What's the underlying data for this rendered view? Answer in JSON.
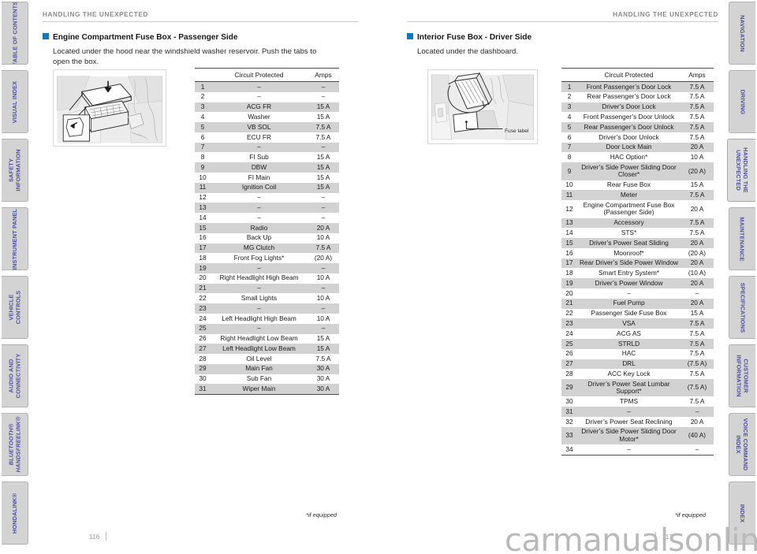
{
  "document": {
    "watermark": "carmanualsonline.info",
    "running_head": "HANDLING THE UNEXPECTED",
    "accent_color": "#1278bd",
    "tab_text_color": "#4b4fa0",
    "tab_bg_color": "#d3d3d3",
    "row_shade_color": "#d2d2d2"
  },
  "left_rail": {
    "items": [
      {
        "label": "TABLE OF CONTENTS",
        "active": false,
        "italic": false
      },
      {
        "label": "VISUAL INDEX",
        "active": false,
        "italic": false
      },
      {
        "label": "SAFETY\nINFORMATION",
        "active": false,
        "italic": false
      },
      {
        "label": "INSTRUMENT PANEL",
        "active": false,
        "italic": false
      },
      {
        "label": "VEHICLE\nCONTROLS",
        "active": false,
        "italic": false
      },
      {
        "label": "AUDIO AND\nCONNECTIVITY",
        "active": false,
        "italic": false
      },
      {
        "label": "BLUETOOTH®\nHANDSFREELINK®",
        "active": false,
        "italic": true
      },
      {
        "label": "HONDALINK®",
        "active": false,
        "italic": false
      }
    ]
  },
  "right_rail": {
    "items": [
      {
        "label": "NAVIGATION",
        "active": false,
        "italic": false
      },
      {
        "label": "DRIVING",
        "active": false,
        "italic": false
      },
      {
        "label": "HANDLING THE\nUNEXPECTED",
        "active": true,
        "italic": false
      },
      {
        "label": "MAINTENANCE",
        "active": false,
        "italic": false
      },
      {
        "label": "SPECIFICATIONS",
        "active": false,
        "italic": false
      },
      {
        "label": "CUSTOMER\nINFORMATION",
        "active": false,
        "italic": false
      },
      {
        "label": "VOICE COMMAND\nINDEX",
        "active": false,
        "italic": false
      },
      {
        "label": "INDEX",
        "active": false,
        "italic": false
      }
    ]
  },
  "left_page": {
    "running_head": "HANDLING THE UNEXPECTED",
    "section_title": "Engine Compartment Fuse Box - Passenger Side",
    "body_text": "Located under the hood near the windshield washer reservoir. Push the tabs to open the box.",
    "illustration_caption": "",
    "footnote": "*if equipped",
    "page_number": "116",
    "table": {
      "headers": [
        "",
        "Circuit Protected",
        "Amps"
      ],
      "rows": [
        [
          "1",
          "–",
          "–"
        ],
        [
          "2",
          "–",
          "–"
        ],
        [
          "3",
          "ACG FR",
          "15 A"
        ],
        [
          "4",
          "Washer",
          "15 A"
        ],
        [
          "5",
          "VB SOL",
          "7.5 A"
        ],
        [
          "6",
          "ECU FR",
          "7.5 A"
        ],
        [
          "7",
          "–",
          "–"
        ],
        [
          "8",
          "FI Sub",
          "15 A"
        ],
        [
          "9",
          "DBW",
          "15 A"
        ],
        [
          "10",
          "FI Main",
          "15 A"
        ],
        [
          "11",
          "Ignition Coil",
          "15 A"
        ],
        [
          "12",
          "–",
          "–"
        ],
        [
          "13",
          "–",
          "–"
        ],
        [
          "14",
          "–",
          "–"
        ],
        [
          "15",
          "Radio",
          "20 A"
        ],
        [
          "16",
          "Back Up",
          "10 A"
        ],
        [
          "17",
          "MG Clutch",
          "7.5 A"
        ],
        [
          "18",
          "Front Fog Lights*",
          "(20 A)"
        ],
        [
          "19",
          "–",
          "–"
        ],
        [
          "20",
          "Right Headlight High Beam",
          "10 A"
        ],
        [
          "21",
          "–",
          "–"
        ],
        [
          "22",
          "Small Lights",
          "10 A"
        ],
        [
          "23",
          "–",
          "–"
        ],
        [
          "24",
          "Left Headlight High Beam",
          "10 A"
        ],
        [
          "25",
          "–",
          "–"
        ],
        [
          "26",
          "Right Headlight Low Beam",
          "15 A"
        ],
        [
          "27",
          "Left Headlight Low Beam",
          "15 A"
        ],
        [
          "28",
          "Oil Level",
          "7.5 A"
        ],
        [
          "29",
          "Main Fan",
          "30 A"
        ],
        [
          "30",
          "Sub Fan",
          "30 A"
        ],
        [
          "31",
          "Wiper Main",
          "30 A"
        ]
      ]
    }
  },
  "right_page": {
    "running_head": "HANDLING THE UNEXPECTED",
    "section_title": "Interior Fuse Box - Driver Side",
    "body_text": "Located under the dashboard.",
    "illustration_caption": "Fuse label",
    "footnote": "*if equipped",
    "page_number": "117",
    "table": {
      "headers": [
        "",
        "Circuit Protected",
        "Amps"
      ],
      "rows": [
        [
          "1",
          "Front Passenger’s Door Lock",
          "7.5 A"
        ],
        [
          "2",
          "Rear Passenger’s Door Lock",
          "7.5 A"
        ],
        [
          "3",
          "Driver’s Door Lock",
          "7.5 A"
        ],
        [
          "4",
          "Front Passenger’s Door Unlock",
          "7.5 A"
        ],
        [
          "5",
          "Rear Passenger’s Door Unlock",
          "7.5 A"
        ],
        [
          "6",
          "Driver’s Door Unlock",
          "7.5 A"
        ],
        [
          "7",
          "Door Lock Main",
          "20 A"
        ],
        [
          "8",
          "HAC Option*",
          "10 A"
        ],
        [
          "9",
          "Driver’s Side Power Sliding Door Closer*",
          "(20 A)"
        ],
        [
          "10",
          "Rear Fuse Box",
          "15 A"
        ],
        [
          "11",
          "Meter",
          "7.5 A"
        ],
        [
          "12",
          "Engine Compartment Fuse Box (Passenger Side)",
          "20 A"
        ],
        [
          "13",
          "Accessory",
          "7.5 A"
        ],
        [
          "14",
          "STS*",
          "7.5 A"
        ],
        [
          "15",
          "Driver’s Power Seat Sliding",
          "20 A"
        ],
        [
          "16",
          "Moonroof*",
          "(20 A)"
        ],
        [
          "17",
          "Rear Driver’s Side Power Window",
          "20 A"
        ],
        [
          "18",
          "Smart Entry System*",
          "(10 A)"
        ],
        [
          "19",
          "Driver’s Power Window",
          "20 A"
        ],
        [
          "20",
          "–",
          "–"
        ],
        [
          "21",
          "Fuel Pump",
          "20 A"
        ],
        [
          "22",
          "Passenger Side Fuse Box",
          "15 A"
        ],
        [
          "23",
          "VSA",
          "7.5 A"
        ],
        [
          "24",
          "ACG AS",
          "7.5 A"
        ],
        [
          "25",
          "STRLD",
          "7.5 A"
        ],
        [
          "26",
          "HAC",
          "7.5 A"
        ],
        [
          "27",
          "DRL",
          "(7.5 A)"
        ],
        [
          "28",
          "ACC Key Lock",
          "7.5 A"
        ],
        [
          "29",
          "Driver’s Power Seat Lumbar Support*",
          "(7.5 A)"
        ],
        [
          "30",
          "TPMS",
          "7.5 A"
        ],
        [
          "31",
          "–",
          "–"
        ],
        [
          "32",
          "Driver’s Power Seat Reclining",
          "20 A"
        ],
        [
          "33",
          "Driver’s Side Power Sliding Door Motor*",
          "(40 A)"
        ],
        [
          "34",
          "–",
          "–"
        ]
      ]
    }
  }
}
